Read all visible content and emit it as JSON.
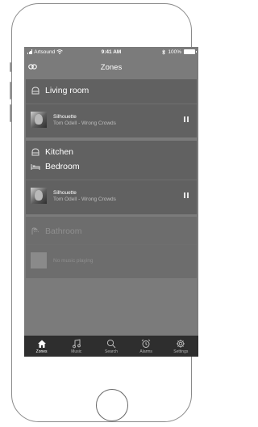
{
  "status_bar": {
    "carrier": "Artsound",
    "time": "9:41 AM",
    "battery": "100%"
  },
  "nav": {
    "title": "Zones"
  },
  "zones": [
    {
      "name": "Living room",
      "track_title": "Silhouette",
      "track_artist": "Tom Odell - Wrong Crowds"
    },
    {
      "names": [
        "Kitchen",
        "Bedroom"
      ],
      "track_title": "Silhouette",
      "track_artist": "Tom Odell - Wrong Crowds"
    },
    {
      "name": "Bathroom",
      "status": "No music playing"
    }
  ],
  "tabs": [
    {
      "label": "Zones",
      "icon": "home-icon",
      "active": true
    },
    {
      "label": "Music",
      "icon": "music-note-icon"
    },
    {
      "label": "Search",
      "icon": "search-icon"
    },
    {
      "label": "Alarms",
      "icon": "alarm-clock-icon"
    },
    {
      "label": "Settings",
      "icon": "gear-icon"
    }
  ]
}
